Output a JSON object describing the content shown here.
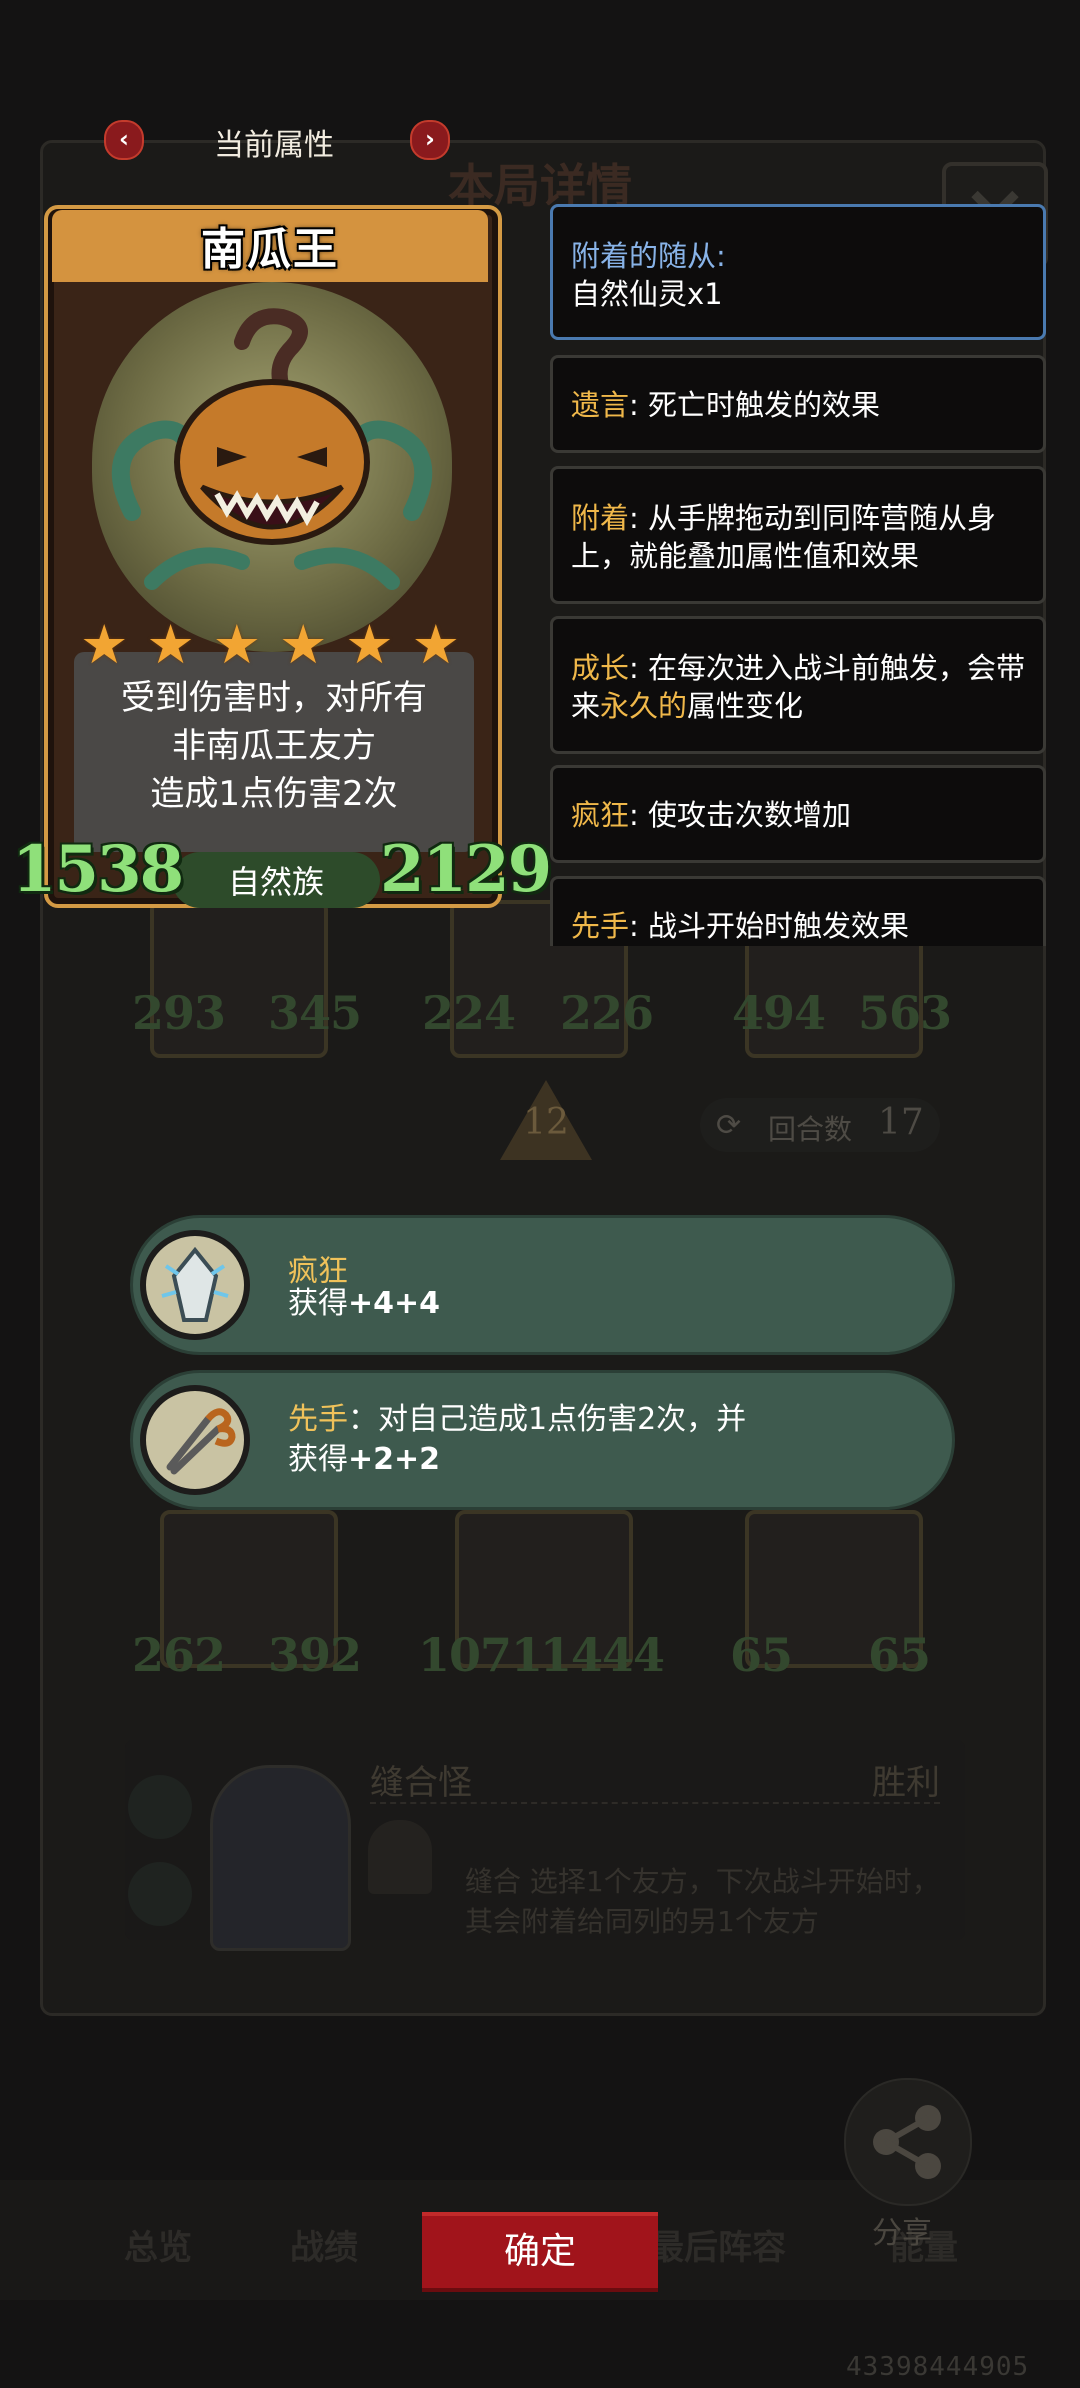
{
  "header": {
    "title": "当前属性",
    "prev": "‹",
    "next": "›"
  },
  "background": {
    "panel_title": "本局详情",
    "minions_row1": [
      {
        "atk": "293",
        "hp": "345"
      },
      {
        "atk": "224",
        "hp": "226"
      },
      {
        "atk": "494",
        "hp": "563"
      }
    ],
    "minions_row2": [
      {
        "atk": "262",
        "hp": "392"
      },
      {
        "atk": "1071",
        "hp": "1444"
      },
      {
        "atk": "65",
        "hp": "65"
      }
    ],
    "round_level": "12",
    "turns_label": "回合数",
    "turns_value": "17",
    "opponent_name": "缝合怪",
    "result": "胜利",
    "hero_power_desc": "缝合 选择1个友方，下次战斗开始时，其会附着给同列的另1个友方",
    "tabs": [
      "总览",
      "战绩",
      "最后阵容",
      "能量"
    ],
    "share_label": "分享",
    "confirm_label": "确定",
    "version": "43398444905"
  },
  "card": {
    "name": "南瓜王",
    "stars": 6,
    "description_lines": [
      "受到伤害时，对所有",
      "非南瓜王友方",
      "造成1点伤害2次"
    ],
    "attack": "1538",
    "health": "2129",
    "tribe": "自然族"
  },
  "keywords": {
    "attached_title": "附着的随从:",
    "attached_value": "自然仙灵x1",
    "deathrattle_key": "遗言",
    "deathrattle_text": ": 死亡时触发的效果",
    "attach_key": "附着",
    "attach_text": ": 从手牌拖动到同阵营随从身上，就能叠加属性值和效果",
    "growth_key": "成长",
    "growth_text_1": ": 在每次进入战斗前触发，会带来",
    "growth_highlight": "永久的",
    "growth_text_2": "属性变化",
    "frenzy_key": "疯狂",
    "frenzy_text": ": 使攻击次数增加",
    "first_key": "先手",
    "first_text": ": 战斗开始时触发效果"
  },
  "effects": {
    "frenzy_name": "疯狂",
    "frenzy_gain_label": "获得",
    "frenzy_gain": "+4+4",
    "first_name": "先手",
    "first_desc": "：对自己造成1点伤害2次，并",
    "first_gain_label": "获得",
    "first_gain": "+2+2"
  }
}
